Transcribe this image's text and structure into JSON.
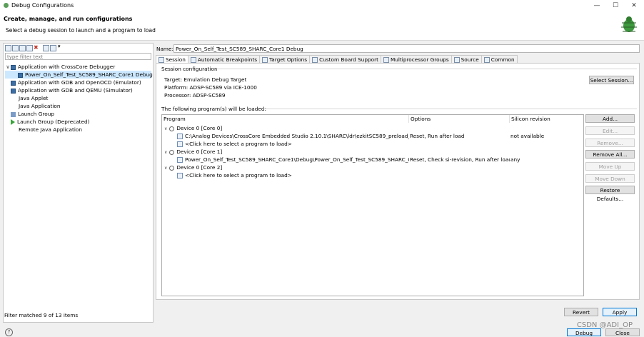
{
  "window": {
    "title": "Debug Configurations",
    "minimize": "—",
    "maximize": "☐",
    "close": "✕"
  },
  "header": {
    "title": "Create, manage, and run configurations",
    "subtitle": "Select a debug session to launch and a program to load"
  },
  "left": {
    "filter_placeholder": "type filter text",
    "tree": [
      {
        "label": "Application with CrossCore Debugger",
        "caret": "∨",
        "level": 0,
        "icon": "app-icon"
      },
      {
        "label": "Power_On_Self_Test_SC589_SHARC_Core1 Debug",
        "level": 1,
        "icon": "app-icon",
        "selected": true
      },
      {
        "label": "Application with GDB and OpenOCD (Emulator)",
        "level": 0,
        "icon": "app-icon"
      },
      {
        "label": "Application with GDB and QEMU (Simulator)",
        "level": 0,
        "icon": "app-icon"
      },
      {
        "label": "Java Applet",
        "level": 0,
        "icon": "none"
      },
      {
        "label": "Java Application",
        "level": 0,
        "icon": "none"
      },
      {
        "label": "Launch Group",
        "level": 0,
        "icon": "group-icon"
      },
      {
        "label": "Launch Group (Deprecated)",
        "level": 0,
        "icon": "run-icon"
      },
      {
        "label": "Remote Java Application",
        "level": 0,
        "icon": "none"
      }
    ],
    "status": "Filter matched 9 of 13 items"
  },
  "main": {
    "name_label": "Name:",
    "name_value": "Power_On_Self_Test_SC589_SHARC_Core1 Debug",
    "tabs": [
      {
        "label": "Session",
        "active": true
      },
      {
        "label": "Automatic Breakpoints"
      },
      {
        "label": "Target Options"
      },
      {
        "label": "Custom Board Support"
      },
      {
        "label": "Multiprocessor Groups"
      },
      {
        "label": "Source"
      },
      {
        "label": "Common"
      }
    ],
    "session_config": "Session configuration",
    "target": "Target: Emulation Debug Target",
    "platform": "Platform: ADSP-SC589 via ICE-1000",
    "processor": "Processor: ADSP-SC589",
    "select_session": "Select Session...",
    "programs_heading": "The following program(s) will be loaded:",
    "columns": [
      "Program",
      "Options",
      "Silicon revision"
    ],
    "rows": [
      {
        "program": "Device 0 [Core 0]",
        "options": "",
        "rev": "",
        "type": "device"
      },
      {
        "program": "C:\\Analog Devices\\CrossCore Embedded Studio 2.10.1\\SHARC\\ldr\\ezkitSC589_preload_cor",
        "options": "Reset, Run after load",
        "rev": "not available",
        "type": "file"
      },
      {
        "program": "<Click here to select a program to load>",
        "options": "",
        "rev": "",
        "type": "file"
      },
      {
        "program": "Device 0 [Core 1]",
        "options": "",
        "rev": "",
        "type": "device"
      },
      {
        "program": "Power_On_Self_Test_SC589_SHARC_Core1\\Debug\\Power_On_Self_Test_SC589_SHARC_Cor",
        "options": "Reset, Check si-revision, Run after load",
        "rev": "any",
        "type": "file"
      },
      {
        "program": "Device 0 [Core 2]",
        "options": "",
        "rev": "",
        "type": "device"
      },
      {
        "program": "<Click here to select a program to load>",
        "options": "",
        "rev": "",
        "type": "file"
      }
    ],
    "side_buttons": [
      {
        "label": "Add...",
        "enabled": true
      },
      {
        "label": "Edit...",
        "enabled": false
      },
      {
        "label": "Remove...",
        "enabled": false
      },
      {
        "label": "Remove All...",
        "enabled": true
      },
      {
        "label": "Move Up",
        "enabled": false
      },
      {
        "label": "Move Down",
        "enabled": false
      },
      {
        "label": "Restore Defaults...",
        "enabled": true
      }
    ],
    "revert": "Revert",
    "apply": "Apply"
  },
  "footer": {
    "help": "?",
    "debug": "Debug",
    "close": "Close"
  },
  "watermark": "CSDN @ADI_OP",
  "colors": {
    "accent": "#0078d7",
    "selection": "#cce8ff"
  }
}
